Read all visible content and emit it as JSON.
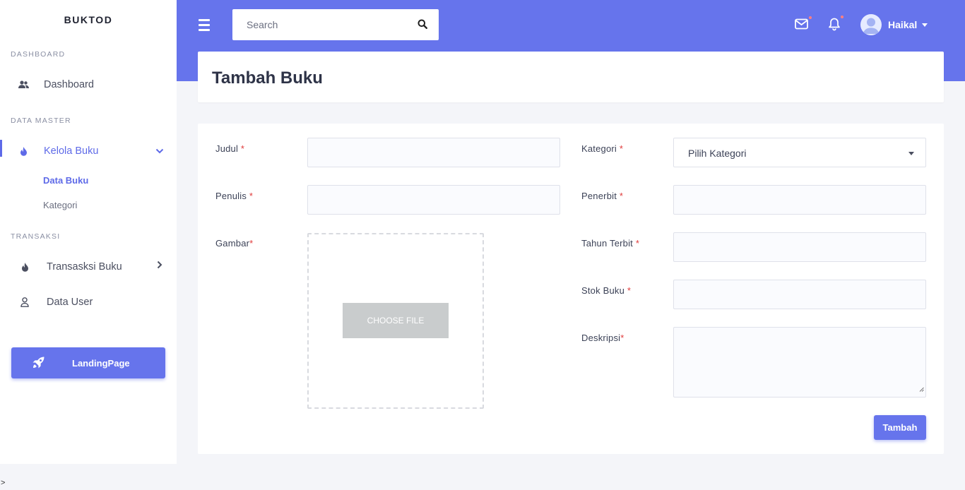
{
  "sidebar": {
    "brand": "BUKTOD",
    "sections": {
      "dashboard": "DASHBOARD",
      "master": "DATA MASTER",
      "transaksi": "TRANSAKSI"
    },
    "items": {
      "dashboard": "Dashboard",
      "kelola_buku": "Kelola Buku",
      "data_buku": "Data Buku",
      "kategori": "Kategori",
      "transaksi_buku": "Transasksi Buku",
      "data_user": "Data User"
    },
    "landing_button": "LandingPage"
  },
  "topbar": {
    "search_placeholder": "Search",
    "user_name": "Haikal"
  },
  "page": {
    "title": "Tambah Buku"
  },
  "form": {
    "judul_label": "Judul",
    "penulis_label": "Penulis",
    "gambar_label": "Gambar",
    "kategori_label": "Kategori",
    "kategori_value": "Pilih Kategori",
    "penerbit_label": "Penerbit",
    "tahun_label": "Tahun Terbit",
    "stok_label": "Stok Buku",
    "deskripsi_label": "Deskripsi",
    "required_mark": "*",
    "choose_file": "CHOOSE FILE",
    "submit": "Tambah"
  },
  "colors": {
    "accent": "#6674ec",
    "required": "#e03b3b"
  },
  "footer": {
    "corner_text": ">"
  }
}
